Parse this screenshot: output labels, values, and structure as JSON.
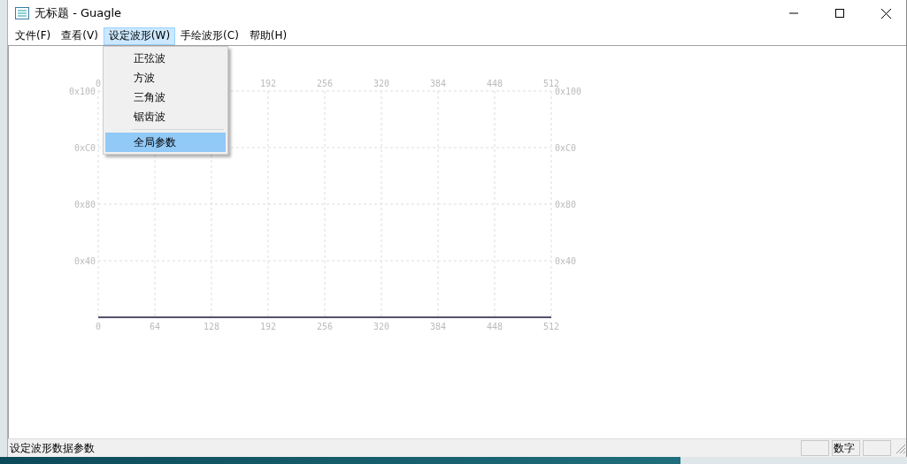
{
  "window": {
    "title": "无标题 - Guagle"
  },
  "menu": [
    {
      "label": "文件(F)",
      "selected": false
    },
    {
      "label": "查看(V)",
      "selected": false
    },
    {
      "label": "设定波形(W)",
      "selected": true
    },
    {
      "label": "手绘波形(C)",
      "selected": false
    },
    {
      "label": "帮助(H)",
      "selected": false
    }
  ],
  "dropdown": {
    "items": [
      {
        "kind": "item",
        "label": "正弦波",
        "selected": false
      },
      {
        "kind": "item",
        "label": "方波",
        "selected": false
      },
      {
        "kind": "item",
        "label": "三角波",
        "selected": false
      },
      {
        "kind": "item",
        "label": "锯齿波",
        "selected": false
      },
      {
        "kind": "separator"
      },
      {
        "kind": "item",
        "label": "全局参数",
        "selected": true
      }
    ]
  },
  "plot": {
    "x_axis_bottom_labels": [
      "0",
      "64",
      "128",
      "192",
      "256",
      "320",
      "384",
      "448",
      "512"
    ],
    "x_axis_top_labels": [
      "0",
      "192",
      "256",
      "320",
      "384",
      "448",
      "512"
    ],
    "y_axis_left_labels": [
      "0x100",
      "0xC0",
      "0x80",
      "0x40"
    ],
    "y_axis_right_labels": [
      "0x100",
      "0xC0",
      "0x80",
      "0x40"
    ]
  },
  "status_bar": {
    "message": "设定波形数据参数",
    "panes": [
      "数字"
    ]
  }
}
